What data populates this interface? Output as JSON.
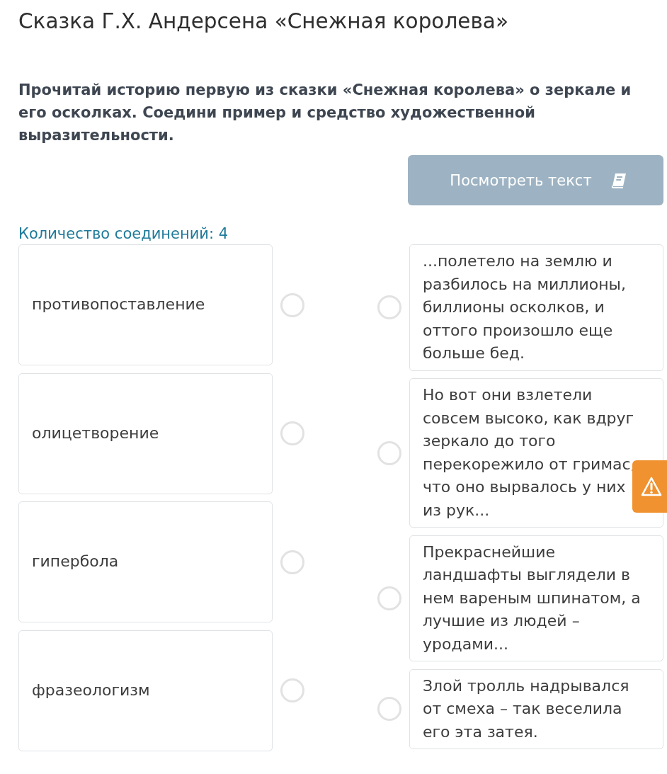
{
  "title": "Сказка Г.Х. Андерсена «Снежная королева»",
  "instruction": "Прочитай историю первую из сказки «Снежная королева» о зеркале и его осколках. Соедини пример и средство художественной выразительности.",
  "view_text_button": {
    "label": "Посмотреть текст"
  },
  "connections_count": "Количество соединений: 4",
  "left_items": [
    {
      "text": "противопоставление",
      "selected": false
    },
    {
      "text": "олицетворение",
      "selected": false
    },
    {
      "text": "гипербола",
      "selected": false
    },
    {
      "text": "фразеологизм",
      "selected": false
    }
  ],
  "right_items": [
    {
      "text": "...полетело на землю и разбилось на миллионы, биллионы осколков, и оттого произошло еще больше бед.",
      "selected": false
    },
    {
      "text": "Но вот они взлетели совсем высоко, как вдруг зеркало до того перекорежило от гримас, что оно вырвалось у них из рук...",
      "selected": false
    },
    {
      "text": "Прекраснейшие ландшафты выглядели в нем вареным шпинатом, а лучшие из людей – уродами...",
      "selected": false
    },
    {
      "text": "Злой тролль надрывался от смеха – так веселила его эта затея.",
      "selected": false
    }
  ]
}
